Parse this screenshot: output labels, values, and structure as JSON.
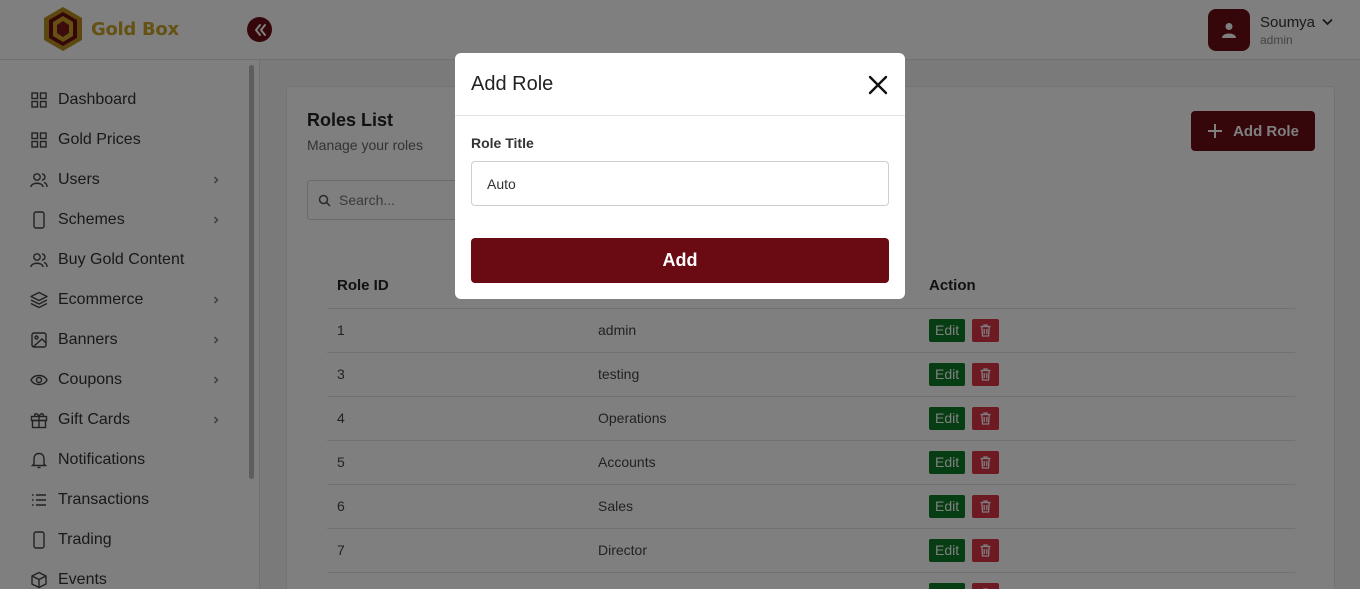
{
  "header": {
    "logo_text": "Gold Box",
    "user": {
      "name": "Soumya",
      "role": "admin"
    }
  },
  "sidebar": {
    "items": [
      {
        "label": "Dashboard",
        "icon": "grid-icon",
        "has_submenu": false
      },
      {
        "label": "Gold Prices",
        "icon": "grid-icon",
        "has_submenu": false
      },
      {
        "label": "Users",
        "icon": "users-icon",
        "has_submenu": true
      },
      {
        "label": "Schemes",
        "icon": "phone-icon",
        "has_submenu": true
      },
      {
        "label": "Buy Gold Content",
        "icon": "users-icon",
        "has_submenu": false
      },
      {
        "label": "Ecommerce",
        "icon": "layers-icon",
        "has_submenu": true
      },
      {
        "label": "Banners",
        "icon": "image-icon",
        "has_submenu": true
      },
      {
        "label": "Coupons",
        "icon": "eye-icon",
        "has_submenu": true
      },
      {
        "label": "Gift Cards",
        "icon": "gift-icon",
        "has_submenu": true
      },
      {
        "label": "Notifications",
        "icon": "bell-icon",
        "has_submenu": false
      },
      {
        "label": "Transactions",
        "icon": "list-icon",
        "has_submenu": false
      },
      {
        "label": "Trading",
        "icon": "phone-icon",
        "has_submenu": false
      },
      {
        "label": "Events",
        "icon": "box-icon",
        "has_submenu": false
      }
    ]
  },
  "main": {
    "title": "Roles List",
    "subtitle": "Manage your roles",
    "add_button_label": "Add Role",
    "search_placeholder": "Search...",
    "table": {
      "headers": {
        "id": "Role ID",
        "action": "Action"
      },
      "edit_label": "Edit",
      "rows": [
        {
          "id": "1",
          "name": "admin"
        },
        {
          "id": "3",
          "name": "testing"
        },
        {
          "id": "4",
          "name": "Operations"
        },
        {
          "id": "5",
          "name": "Accounts"
        },
        {
          "id": "6",
          "name": "Sales"
        },
        {
          "id": "7",
          "name": "Director"
        }
      ]
    }
  },
  "modal": {
    "title": "Add Role",
    "field_label": "Role Title",
    "field_value": "Auto",
    "submit_label": "Add"
  },
  "colors": {
    "brand": "#6a0f16",
    "gold": "#c9a227",
    "edit": "#0f7b24",
    "delete": "#dc3545"
  }
}
